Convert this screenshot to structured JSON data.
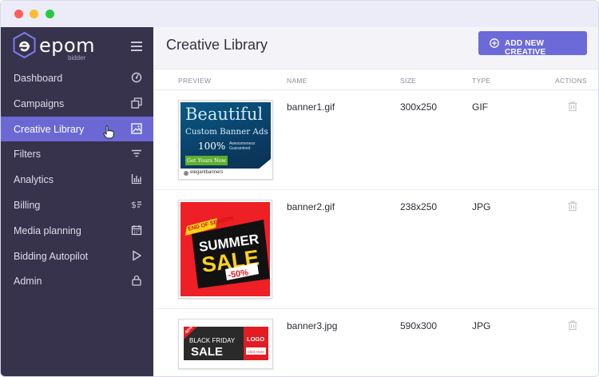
{
  "window": {
    "controls": [
      "close",
      "minimize",
      "maximize"
    ]
  },
  "brand": {
    "name": "epom",
    "sub": "bidder",
    "colors": {
      "sidebar": "#37334c",
      "accent": "#6b68d4"
    }
  },
  "sidebar": {
    "menu_icon": "hamburger-icon",
    "items": [
      {
        "label": "Dashboard",
        "icon": "dashboard-icon",
        "active": false
      },
      {
        "label": "Campaigns",
        "icon": "campaigns-icon",
        "active": false
      },
      {
        "label": "Creative Library",
        "icon": "image-icon",
        "active": true
      },
      {
        "label": "Filters",
        "icon": "filter-icon",
        "active": false
      },
      {
        "label": "Analytics",
        "icon": "bar-chart-icon",
        "active": false
      },
      {
        "label": "Billing",
        "icon": "billing-icon",
        "active": false
      },
      {
        "label": "Media planning",
        "icon": "calendar-icon",
        "active": false
      },
      {
        "label": "Bidding Autopilot",
        "icon": "play-icon",
        "active": false
      },
      {
        "label": "Admin",
        "icon": "lock-icon",
        "active": false
      }
    ]
  },
  "header": {
    "title": "Creative Library",
    "add_button": "ADD NEW CREATIVE"
  },
  "table": {
    "columns": [
      "PREVIEW",
      "NAME",
      "SIZE",
      "TYPE",
      "ACTIONS"
    ],
    "rows": [
      {
        "name": "banner1.gif",
        "size": "300x250",
        "type": "GIF",
        "preview": {
          "headline": "Beautiful",
          "subline": "Custom Banner Ads",
          "percent": "100%",
          "badge": "Awesomeness Guaranteed",
          "cta": "Get Yours Now",
          "footer": "elegantbanners"
        }
      },
      {
        "name": "banner2.gif",
        "size": "238x250",
        "type": "JPG",
        "preview": {
          "ribbon": "END OF SEASON",
          "line1": "SUMMER",
          "line2": "SALE",
          "discount": "-50%"
        }
      },
      {
        "name": "banner3.jpg",
        "size": "590x300",
        "type": "JPG",
        "preview": {
          "tag": "-50%",
          "line1": "BLACK FRIDAY",
          "line2": "SALE",
          "logo": "LOGO",
          "cta": "Click Here"
        }
      }
    ]
  }
}
